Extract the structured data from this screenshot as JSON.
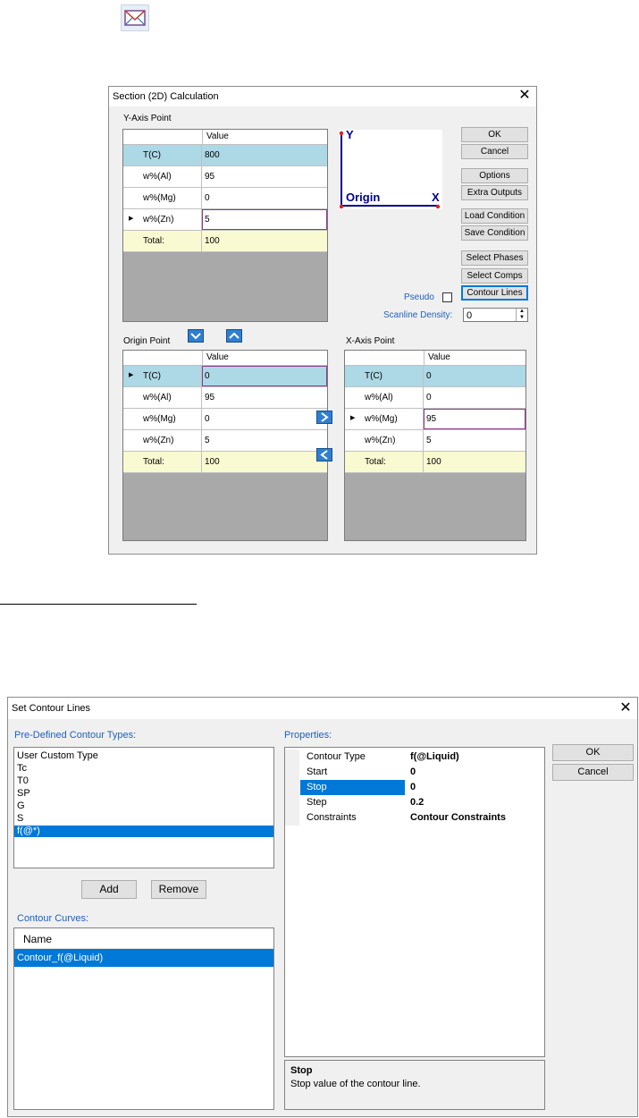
{
  "top_icon": "envelope-chart-icon",
  "section_dialog": {
    "title": "Section (2D) Calculation",
    "close": "✕",
    "y_axis": {
      "label": "Y-Axis Point",
      "value_header": "Value",
      "rows": [
        {
          "name": "T(C)",
          "value": "800"
        },
        {
          "name": "w%(Al)",
          "value": "95"
        },
        {
          "name": "w%(Mg)",
          "value": "0"
        },
        {
          "name": "w%(Zn)",
          "value": "5"
        },
        {
          "name": "Total:",
          "value": "100"
        }
      ]
    },
    "axis_preview": {
      "y": "Y",
      "x": "X",
      "origin": "Origin"
    },
    "buttons": {
      "ok": "OK",
      "cancel": "Cancel",
      "options": "Options",
      "extra_outputs": "Extra Outputs",
      "load_condition": "Load Condition",
      "save_condition": "Save Condition",
      "select_phases": "Select Phases",
      "select_comps": "Select Comps",
      "contour_lines": "Contour Lines"
    },
    "pseudo_label": "Pseudo",
    "scanline_label": "Scanline Density:",
    "scanline_value": "0",
    "origin": {
      "label": "Origin Point",
      "value_header": "Value",
      "rows": [
        {
          "name": "T(C)",
          "value": "0"
        },
        {
          "name": "w%(Al)",
          "value": "95"
        },
        {
          "name": "w%(Mg)",
          "value": "0"
        },
        {
          "name": "w%(Zn)",
          "value": "5"
        },
        {
          "name": "Total:",
          "value": "100"
        }
      ]
    },
    "x_axis": {
      "label": "X-Axis Point",
      "value_header": "Value",
      "rows": [
        {
          "name": "T(C)",
          "value": "0"
        },
        {
          "name": "w%(Al)",
          "value": "0"
        },
        {
          "name": "w%(Mg)",
          "value": "95"
        },
        {
          "name": "w%(Zn)",
          "value": "5"
        },
        {
          "name": "Total:",
          "value": "100"
        }
      ]
    }
  },
  "contour_dialog": {
    "title": "Set Contour Lines",
    "close": "✕",
    "predefined_label": "Pre-Defined Contour Types:",
    "predefined_items": [
      "User Custom Type",
      "Tc",
      "T0",
      "SP",
      "G",
      "S",
      "f(@*)"
    ],
    "add": "Add",
    "remove": "Remove",
    "curves_label": "Contour Curves:",
    "curves_header": "Name",
    "curves": [
      "Contour_f(@Liquid)"
    ],
    "properties_label": "Properties:",
    "properties": [
      {
        "name": "Contour Type",
        "value": "f(@Liquid)"
      },
      {
        "name": "Start",
        "value": "0"
      },
      {
        "name": "Stop",
        "value": "0"
      },
      {
        "name": "Step",
        "value": "0.2"
      },
      {
        "name": "Constraints",
        "value": "Contour Constraints"
      }
    ],
    "help_title": "Stop",
    "help_text": "Stop value of the contour line.",
    "ok": "OK",
    "cancel": "Cancel"
  }
}
